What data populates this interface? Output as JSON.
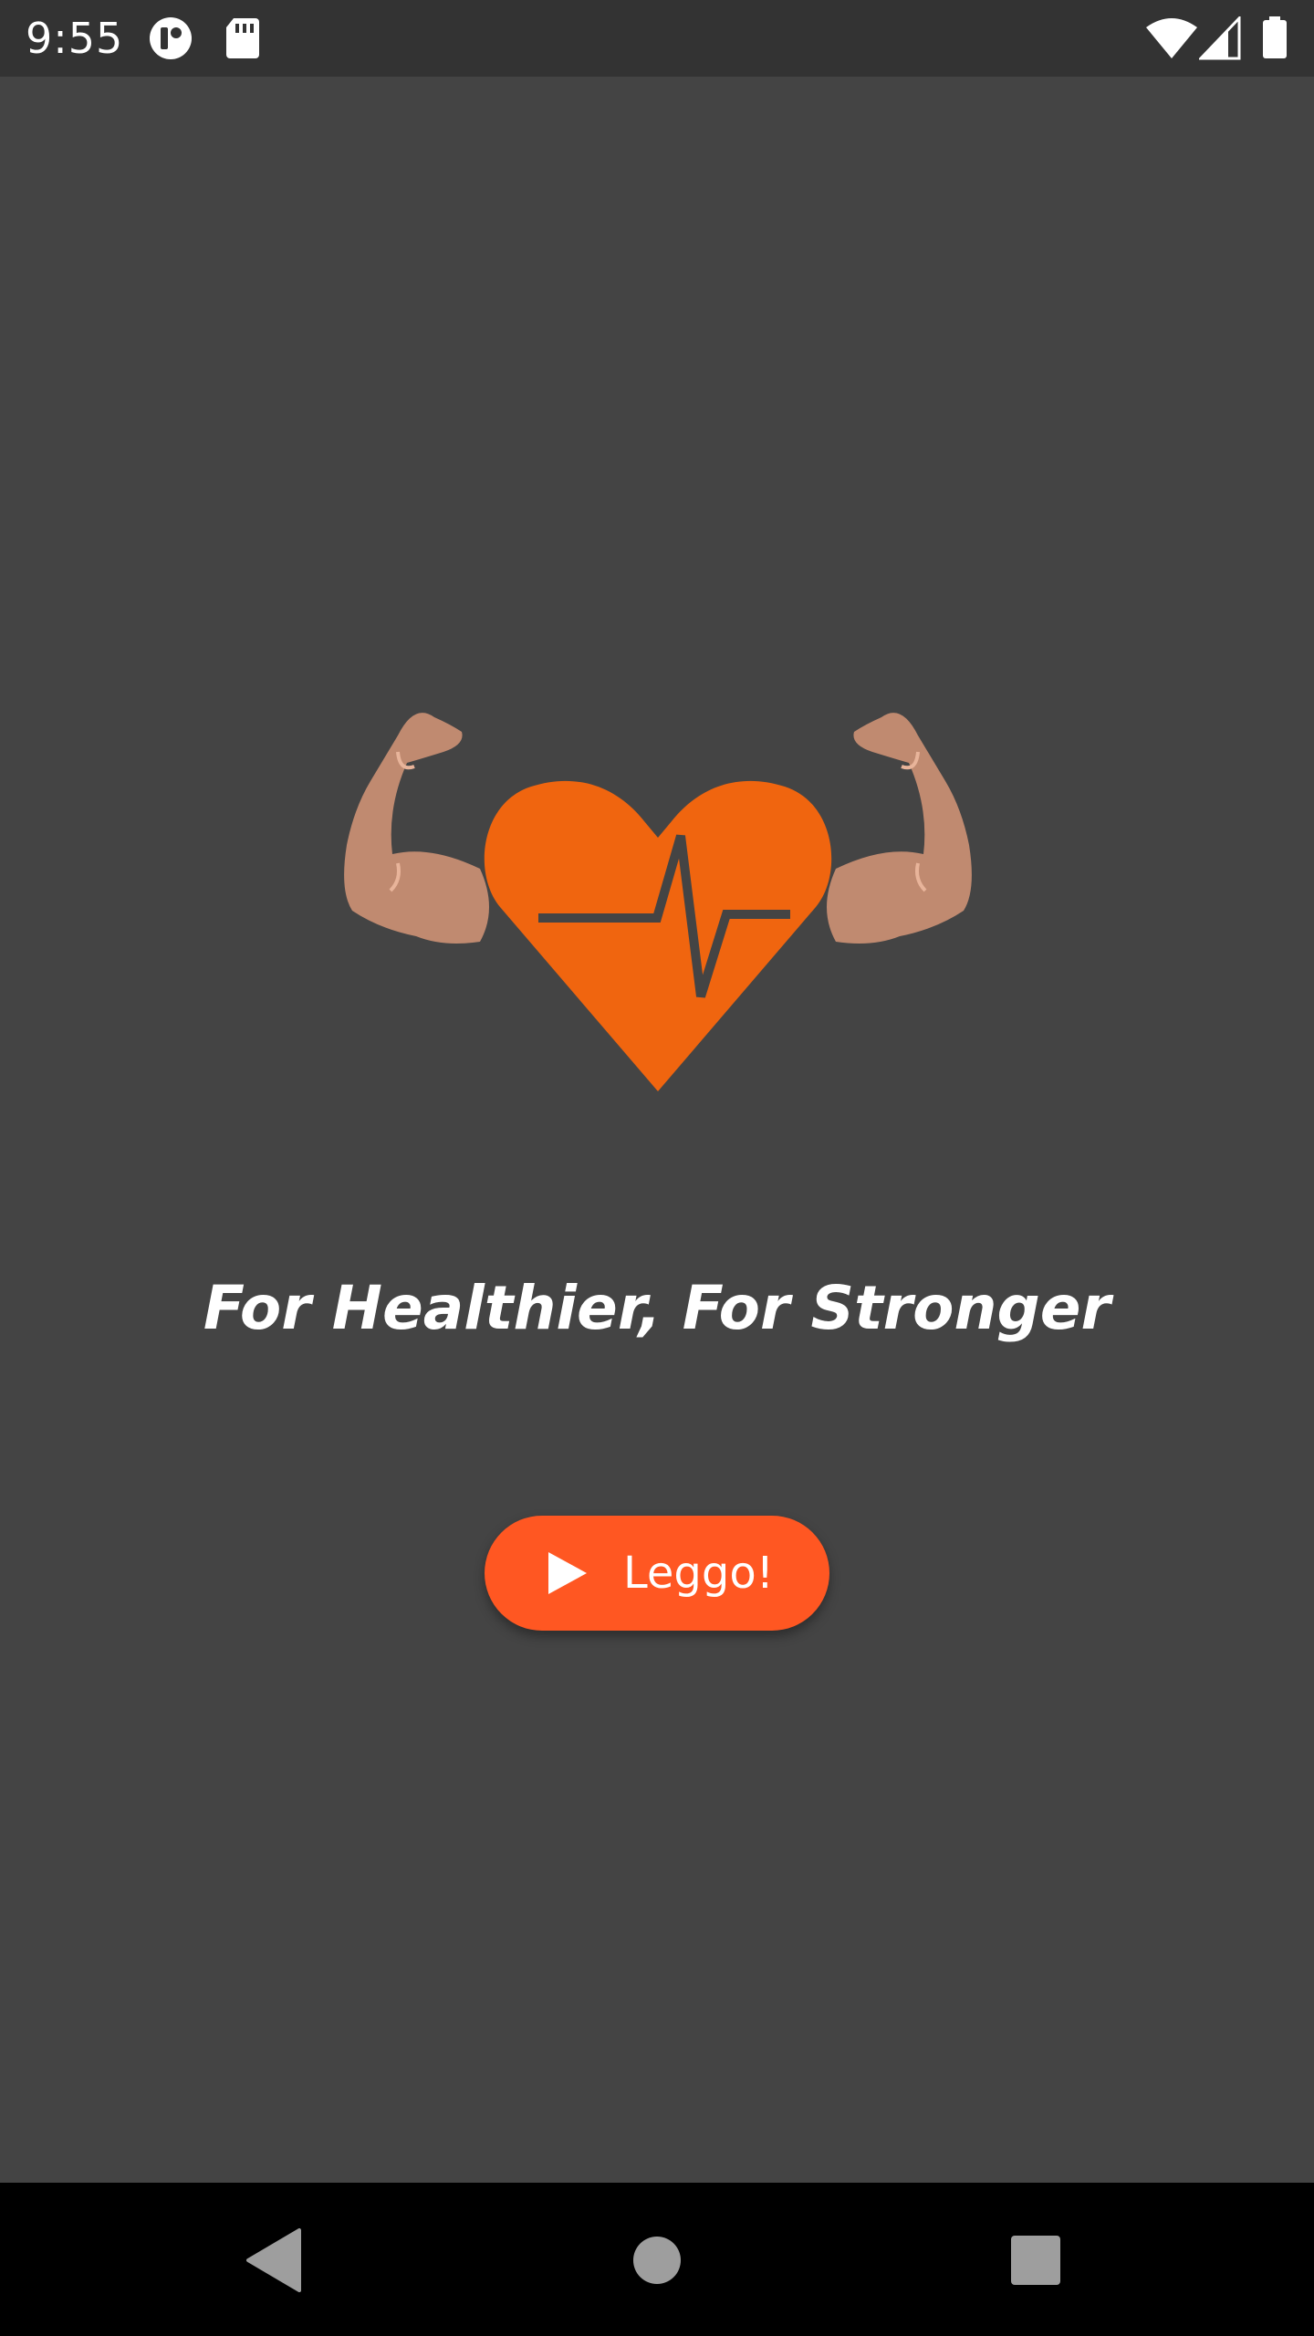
{
  "status_bar": {
    "time": "9:55",
    "icons": [
      "app-notification-icon",
      "sd-card-icon",
      "wifi-icon",
      "cell-signal-icon",
      "battery-icon"
    ]
  },
  "splash": {
    "logo_icon": "muscle-heart-icon",
    "tagline": "For Healthier, For Stronger",
    "button_label": "Leggo!",
    "button_icon": "play-icon"
  },
  "nav_bar": {
    "buttons": [
      "back-icon",
      "home-icon",
      "recents-icon"
    ]
  },
  "colors": {
    "background": "#444444",
    "status_bar": "#333333",
    "nav_bar": "#000000",
    "accent": "#ff5722",
    "heart": "#f0650f",
    "skin": "#c08a70"
  }
}
